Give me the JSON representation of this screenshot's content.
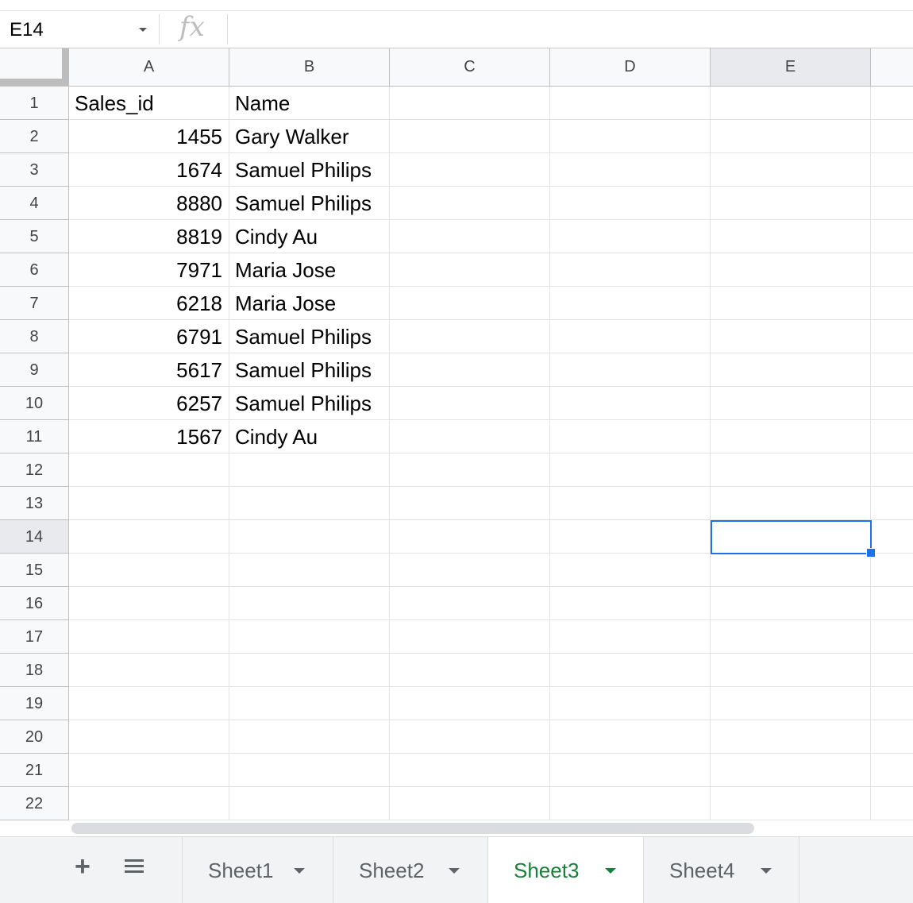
{
  "name_box": {
    "value": "E14"
  },
  "formula_bar": {
    "icon": "fx-icon",
    "value": ""
  },
  "columns": [
    "A",
    "B",
    "C",
    "D",
    "E"
  ],
  "selected_column": "E",
  "rows": [
    "1",
    "2",
    "3",
    "4",
    "5",
    "6",
    "7",
    "8",
    "9",
    "10",
    "11",
    "12",
    "13",
    "14",
    "15",
    "16",
    "17",
    "18",
    "19",
    "20",
    "21",
    "22"
  ],
  "selected_row": "14",
  "cells": {
    "header": {
      "a": "Sales_id",
      "b": "Name"
    },
    "data": [
      {
        "a": "1455",
        "b": "Gary Walker"
      },
      {
        "a": "1674",
        "b": "Samuel Philips"
      },
      {
        "a": "8880",
        "b": "Samuel Philips"
      },
      {
        "a": "8819",
        "b": "Cindy Au"
      },
      {
        "a": "7971",
        "b": "Maria Jose"
      },
      {
        "a": "6218",
        "b": "Maria Jose"
      },
      {
        "a": "6791",
        "b": "Samuel Philips"
      },
      {
        "a": "5617",
        "b": "Samuel Philips"
      },
      {
        "a": "6257",
        "b": "Samuel Philips"
      },
      {
        "a": "1567",
        "b": "Cindy Au"
      }
    ]
  },
  "sheet_tabs": [
    {
      "label": "Sheet1",
      "active": false
    },
    {
      "label": "Sheet2",
      "active": false
    },
    {
      "label": "Sheet3",
      "active": true
    },
    {
      "label": "Sheet4",
      "active": false
    }
  ],
  "colors": {
    "accent": "#1a73e8",
    "active_tab": "#188038"
  }
}
